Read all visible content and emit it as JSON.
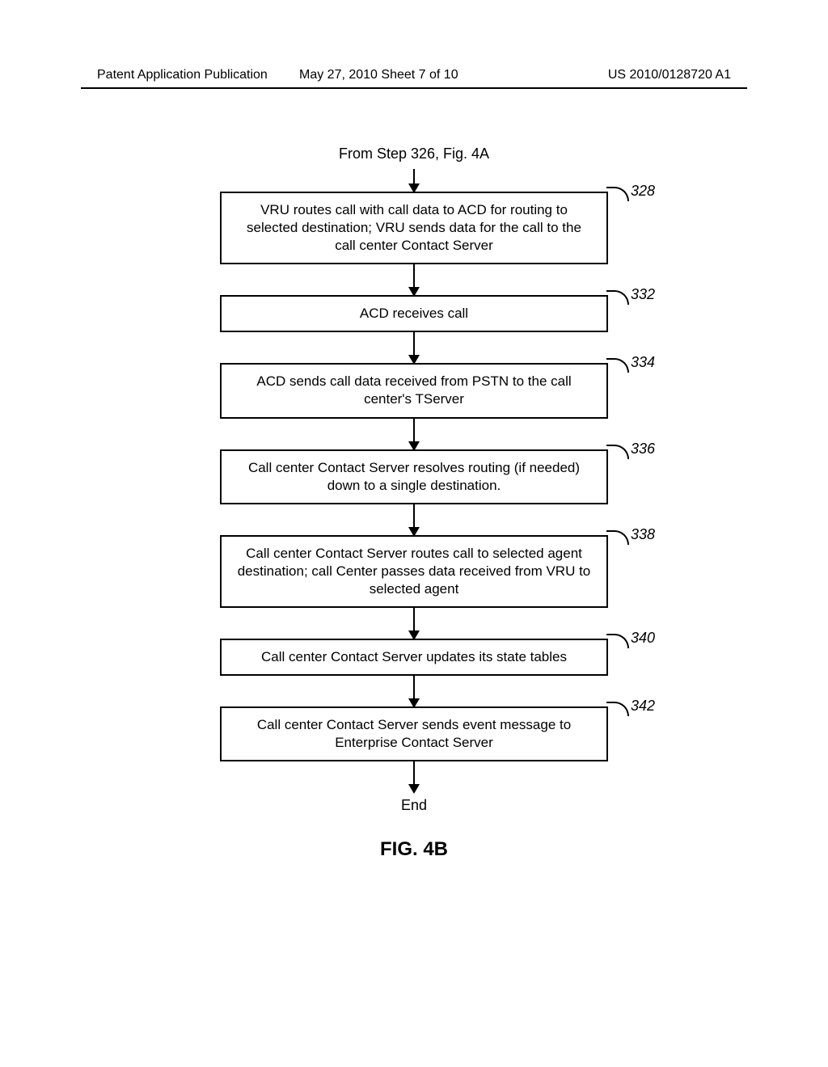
{
  "header": {
    "left": "Patent Application Publication",
    "center": "May 27, 2010  Sheet 7 of 10",
    "right": "US 2010/0128720 A1"
  },
  "flowchart": {
    "start": "From Step 326, Fig. 4A",
    "steps": [
      {
        "ref": "328",
        "text": "VRU routes call with call data to ACD for routing to selected destination; VRU sends data for the call to the call center Contact Server"
      },
      {
        "ref": "332",
        "text": "ACD receives call"
      },
      {
        "ref": "334",
        "text": "ACD sends call data received from PSTN to the call center's TServer"
      },
      {
        "ref": "336",
        "text": "Call center Contact Server resolves routing (if needed) down to a single destination."
      },
      {
        "ref": "338",
        "text": "Call center Contact Server routes call to selected agent destination; call Center passes data received from VRU to selected agent"
      },
      {
        "ref": "340",
        "text": "Call center Contact Server updates its state tables"
      },
      {
        "ref": "342",
        "text": "Call center Contact Server sends event message to Enterprise Contact Server"
      }
    ],
    "end": "End",
    "figLabel": "FIG. 4B"
  }
}
